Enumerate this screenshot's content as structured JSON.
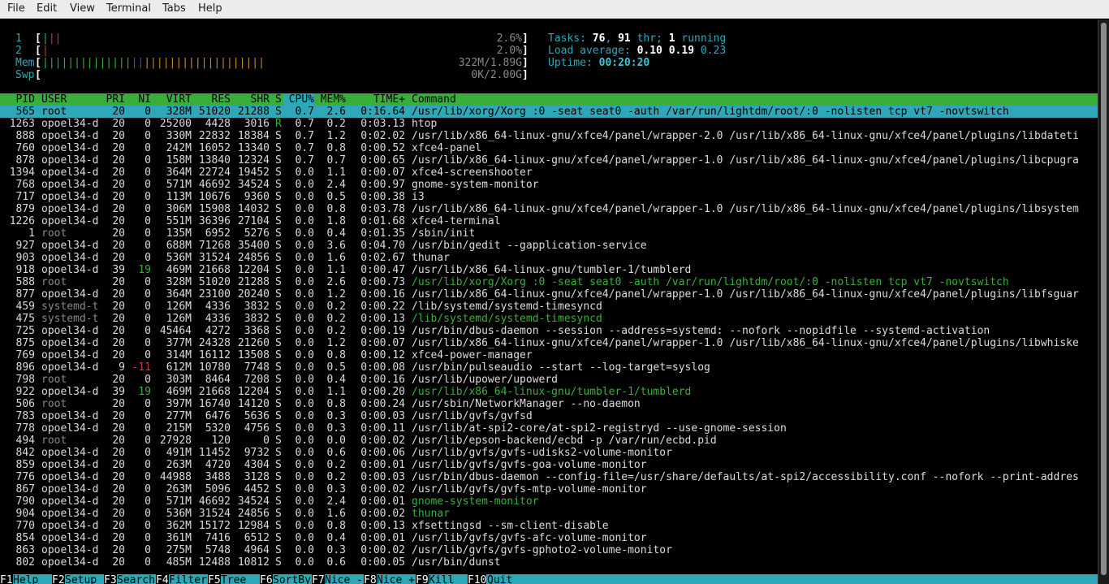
{
  "menubar": {
    "items": [
      "File",
      "Edit",
      "View",
      "Terminal",
      "Tabs",
      "Help"
    ]
  },
  "meters": {
    "cpu1": {
      "label": "1",
      "value": "2.6%"
    },
    "cpu2": {
      "label": "2",
      "value": "2.0%"
    },
    "mem": {
      "label": "Mem",
      "value": "322M/1.89G"
    },
    "swp": {
      "label": "Swp",
      "value": "0K/2.00G"
    }
  },
  "summary": {
    "tasks_label": "Tasks: ",
    "tasks": "76",
    "sep1": ", ",
    "threads": "91",
    "thr_label": " thr; ",
    "running": "1",
    "running_label": " running",
    "load_label": "Load average: ",
    "load1": "0.10",
    "load5": "0.19",
    "load15": "0.23",
    "uptime_label": "Uptime: ",
    "uptime": "00:20:20"
  },
  "columns": [
    "PID",
    "USER",
    "PRI",
    "NI",
    "VIRT",
    "RES",
    "SHR",
    "S",
    "CPU%",
    "MEM%",
    "TIME+",
    "Command"
  ],
  "colors": {
    "cyan": "#2ea8b8",
    "green": "#3aae3a",
    "header_bg": "#3aae3a",
    "selected_bg": "#2ea8b8"
  },
  "processes": [
    {
      "pid": "565",
      "user": "root",
      "pri": "20",
      "ni": "0",
      "virt": "328M",
      "res": "51020",
      "shr": "21288",
      "s": "S",
      "cpu": "0.7",
      "mem": "2.6",
      "time": "0:16.64",
      "cmd": "/usr/lib/xorg/Xorg :0 -seat seat0 -auth /var/run/lightdm/root/:0 -nolisten tcp vt7 -novtswitch",
      "sel": true
    },
    {
      "pid": "1263",
      "user": "opoel34-d",
      "pri": "20",
      "ni": "0",
      "virt": "25200",
      "res": "4428",
      "shr": "3016",
      "s": "R",
      "cpu": "0.7",
      "mem": "0.2",
      "time": "0:03.13",
      "cmd": "htop"
    },
    {
      "pid": "888",
      "user": "opoel34-d",
      "pri": "20",
      "ni": "0",
      "virt": "330M",
      "res": "22832",
      "shr": "18384",
      "s": "S",
      "cpu": "0.7",
      "mem": "1.2",
      "time": "0:02.02",
      "cmd": "/usr/lib/x86_64-linux-gnu/xfce4/panel/wrapper-2.0 /usr/lib/x86_64-linux-gnu/xfce4/panel/plugins/libdateti"
    },
    {
      "pid": "760",
      "user": "opoel34-d",
      "pri": "20",
      "ni": "0",
      "virt": "242M",
      "res": "16052",
      "shr": "13340",
      "s": "S",
      "cpu": "0.7",
      "mem": "0.8",
      "time": "0:00.52",
      "cmd": "xfce4-panel"
    },
    {
      "pid": "878",
      "user": "opoel34-d",
      "pri": "20",
      "ni": "0",
      "virt": "158M",
      "res": "13840",
      "shr": "12324",
      "s": "S",
      "cpu": "0.7",
      "mem": "0.7",
      "time": "0:00.65",
      "cmd": "/usr/lib/x86_64-linux-gnu/xfce4/panel/wrapper-1.0 /usr/lib/x86_64-linux-gnu/xfce4/panel/plugins/libcpugra"
    },
    {
      "pid": "1394",
      "user": "opoel34-d",
      "pri": "20",
      "ni": "0",
      "virt": "364M",
      "res": "22724",
      "shr": "19452",
      "s": "S",
      "cpu": "0.0",
      "mem": "1.1",
      "time": "0:00.07",
      "cmd": "xfce4-screenshooter"
    },
    {
      "pid": "768",
      "user": "opoel34-d",
      "pri": "20",
      "ni": "0",
      "virt": "571M",
      "res": "46692",
      "shr": "34524",
      "s": "S",
      "cpu": "0.0",
      "mem": "2.4",
      "time": "0:00.97",
      "cmd": "gnome-system-monitor"
    },
    {
      "pid": "717",
      "user": "opoel34-d",
      "pri": "20",
      "ni": "0",
      "virt": "113M",
      "res": "10676",
      "shr": "9360",
      "s": "S",
      "cpu": "0.0",
      "mem": "0.5",
      "time": "0:00.38",
      "cmd": "i3"
    },
    {
      "pid": "879",
      "user": "opoel34-d",
      "pri": "20",
      "ni": "0",
      "virt": "306M",
      "res": "15908",
      "shr": "14032",
      "s": "S",
      "cpu": "0.0",
      "mem": "0.8",
      "time": "0:03.78",
      "cmd": "/usr/lib/x86_64-linux-gnu/xfce4/panel/wrapper-1.0 /usr/lib/x86_64-linux-gnu/xfce4/panel/plugins/libsystem"
    },
    {
      "pid": "1226",
      "user": "opoel34-d",
      "pri": "20",
      "ni": "0",
      "virt": "551M",
      "res": "36396",
      "shr": "27104",
      "s": "S",
      "cpu": "0.0",
      "mem": "1.8",
      "time": "0:01.68",
      "cmd": "xfce4-terminal"
    },
    {
      "pid": "1",
      "user": "root",
      "pri": "20",
      "ni": "0",
      "virt": "135M",
      "res": "6952",
      "shr": "5276",
      "s": "S",
      "cpu": "0.0",
      "mem": "0.4",
      "time": "0:01.35",
      "cmd": "/sbin/init"
    },
    {
      "pid": "927",
      "user": "opoel34-d",
      "pri": "20",
      "ni": "0",
      "virt": "688M",
      "res": "71268",
      "shr": "35400",
      "s": "S",
      "cpu": "0.0",
      "mem": "3.6",
      "time": "0:04.70",
      "cmd": "/usr/bin/gedit --gapplication-service"
    },
    {
      "pid": "903",
      "user": "opoel34-d",
      "pri": "20",
      "ni": "0",
      "virt": "536M",
      "res": "31524",
      "shr": "24856",
      "s": "S",
      "cpu": "0.0",
      "mem": "1.6",
      "time": "0:02.67",
      "cmd": "thunar"
    },
    {
      "pid": "918",
      "user": "opoel34-d",
      "pri": "39",
      "ni": "19",
      "virt": "469M",
      "res": "21668",
      "shr": "12204",
      "s": "S",
      "cpu": "0.0",
      "mem": "1.1",
      "time": "0:00.47",
      "cmd": "/usr/lib/x86_64-linux-gnu/tumbler-1/tumblerd"
    },
    {
      "pid": "588",
      "user": "root",
      "pri": "20",
      "ni": "0",
      "virt": "328M",
      "res": "51020",
      "shr": "21288",
      "s": "S",
      "cpu": "0.0",
      "mem": "2.6",
      "time": "0:00.73",
      "cmd": "/usr/lib/xorg/Xorg :0 -seat seat0 -auth /var/run/lightdm/root/:0 -nolisten tcp vt7 -novtswitch",
      "thread": true
    },
    {
      "pid": "877",
      "user": "opoel34-d",
      "pri": "20",
      "ni": "0",
      "virt": "364M",
      "res": "23100",
      "shr": "20240",
      "s": "S",
      "cpu": "0.0",
      "mem": "1.2",
      "time": "0:00.16",
      "cmd": "/usr/lib/x86_64-linux-gnu/xfce4/panel/wrapper-1.0 /usr/lib/x86_64-linux-gnu/xfce4/panel/plugins/libfsguar"
    },
    {
      "pid": "459",
      "user": "systemd-t",
      "pri": "20",
      "ni": "0",
      "virt": "126M",
      "res": "4336",
      "shr": "3832",
      "s": "S",
      "cpu": "0.0",
      "mem": "0.2",
      "time": "0:00.22",
      "cmd": "/lib/systemd/systemd-timesyncd"
    },
    {
      "pid": "475",
      "user": "systemd-t",
      "pri": "20",
      "ni": "0",
      "virt": "126M",
      "res": "4336",
      "shr": "3832",
      "s": "S",
      "cpu": "0.0",
      "mem": "0.2",
      "time": "0:00.13",
      "cmd": "/lib/systemd/systemd-timesyncd",
      "thread": true
    },
    {
      "pid": "725",
      "user": "opoel34-d",
      "pri": "20",
      "ni": "0",
      "virt": "45464",
      "res": "4272",
      "shr": "3368",
      "s": "S",
      "cpu": "0.0",
      "mem": "0.2",
      "time": "0:00.19",
      "cmd": "/usr/bin/dbus-daemon --session --address=systemd: --nofork --nopidfile --systemd-activation"
    },
    {
      "pid": "875",
      "user": "opoel34-d",
      "pri": "20",
      "ni": "0",
      "virt": "377M",
      "res": "24328",
      "shr": "21260",
      "s": "S",
      "cpu": "0.0",
      "mem": "1.2",
      "time": "0:00.07",
      "cmd": "/usr/lib/x86_64-linux-gnu/xfce4/panel/wrapper-1.0 /usr/lib/x86_64-linux-gnu/xfce4/panel/plugins/libwhiske"
    },
    {
      "pid": "769",
      "user": "opoel34-d",
      "pri": "20",
      "ni": "0",
      "virt": "314M",
      "res": "16112",
      "shr": "13508",
      "s": "S",
      "cpu": "0.0",
      "mem": "0.8",
      "time": "0:00.12",
      "cmd": "xfce4-power-manager"
    },
    {
      "pid": "896",
      "user": "opoel34-d",
      "pri": "9",
      "ni": "-11",
      "virt": "612M",
      "res": "10780",
      "shr": "7748",
      "s": "S",
      "cpu": "0.0",
      "mem": "0.5",
      "time": "0:00.08",
      "cmd": "/usr/bin/pulseaudio --start --log-target=syslog"
    },
    {
      "pid": "798",
      "user": "root",
      "pri": "20",
      "ni": "0",
      "virt": "303M",
      "res": "8464",
      "shr": "7208",
      "s": "S",
      "cpu": "0.0",
      "mem": "0.4",
      "time": "0:00.16",
      "cmd": "/usr/lib/upower/upowerd"
    },
    {
      "pid": "922",
      "user": "opoel34-d",
      "pri": "39",
      "ni": "19",
      "virt": "469M",
      "res": "21668",
      "shr": "12204",
      "s": "S",
      "cpu": "0.0",
      "mem": "1.1",
      "time": "0:00.20",
      "cmd": "/usr/lib/x86_64-linux-gnu/tumbler-1/tumblerd",
      "thread": true
    },
    {
      "pid": "506",
      "user": "root",
      "pri": "20",
      "ni": "0",
      "virt": "397M",
      "res": "16740",
      "shr": "14120",
      "s": "S",
      "cpu": "0.0",
      "mem": "0.8",
      "time": "0:00.24",
      "cmd": "/usr/sbin/NetworkManager --no-daemon"
    },
    {
      "pid": "783",
      "user": "opoel34-d",
      "pri": "20",
      "ni": "0",
      "virt": "277M",
      "res": "6476",
      "shr": "5636",
      "s": "S",
      "cpu": "0.0",
      "mem": "0.3",
      "time": "0:00.03",
      "cmd": "/usr/lib/gvfs/gvfsd"
    },
    {
      "pid": "778",
      "user": "opoel34-d",
      "pri": "20",
      "ni": "0",
      "virt": "215M",
      "res": "5320",
      "shr": "4756",
      "s": "S",
      "cpu": "0.0",
      "mem": "0.3",
      "time": "0:00.11",
      "cmd": "/usr/lib/at-spi2-core/at-spi2-registryd --use-gnome-session"
    },
    {
      "pid": "494",
      "user": "root",
      "pri": "20",
      "ni": "0",
      "virt": "27928",
      "res": "120",
      "shr": "0",
      "s": "S",
      "cpu": "0.0",
      "mem": "0.0",
      "time": "0:00.02",
      "cmd": "/usr/lib/epson-backend/ecbd -p /var/run/ecbd.pid"
    },
    {
      "pid": "842",
      "user": "opoel34-d",
      "pri": "20",
      "ni": "0",
      "virt": "491M",
      "res": "11452",
      "shr": "9732",
      "s": "S",
      "cpu": "0.0",
      "mem": "0.6",
      "time": "0:00.06",
      "cmd": "/usr/lib/gvfs/gvfs-udisks2-volume-monitor"
    },
    {
      "pid": "859",
      "user": "opoel34-d",
      "pri": "20",
      "ni": "0",
      "virt": "263M",
      "res": "4720",
      "shr": "4304",
      "s": "S",
      "cpu": "0.0",
      "mem": "0.2",
      "time": "0:00.01",
      "cmd": "/usr/lib/gvfs/gvfs-goa-volume-monitor"
    },
    {
      "pid": "776",
      "user": "opoel34-d",
      "pri": "20",
      "ni": "0",
      "virt": "44988",
      "res": "3488",
      "shr": "3128",
      "s": "S",
      "cpu": "0.0",
      "mem": "0.2",
      "time": "0:00.03",
      "cmd": "/usr/bin/dbus-daemon --config-file=/usr/share/defaults/at-spi2/accessibility.conf --nofork --print-addres"
    },
    {
      "pid": "867",
      "user": "opoel34-d",
      "pri": "20",
      "ni": "0",
      "virt": "263M",
      "res": "5096",
      "shr": "4452",
      "s": "S",
      "cpu": "0.0",
      "mem": "0.3",
      "time": "0:00.02",
      "cmd": "/usr/lib/gvfs/gvfs-mtp-volume-monitor"
    },
    {
      "pid": "790",
      "user": "opoel34-d",
      "pri": "20",
      "ni": "0",
      "virt": "571M",
      "res": "46692",
      "shr": "34524",
      "s": "S",
      "cpu": "0.0",
      "mem": "2.4",
      "time": "0:00.01",
      "cmd": "gnome-system-monitor",
      "thread": true
    },
    {
      "pid": "904",
      "user": "opoel34-d",
      "pri": "20",
      "ni": "0",
      "virt": "536M",
      "res": "31524",
      "shr": "24856",
      "s": "S",
      "cpu": "0.0",
      "mem": "1.6",
      "time": "0:00.02",
      "cmd": "thunar",
      "thread": true
    },
    {
      "pid": "770",
      "user": "opoel34-d",
      "pri": "20",
      "ni": "0",
      "virt": "362M",
      "res": "15172",
      "shr": "12984",
      "s": "S",
      "cpu": "0.0",
      "mem": "0.8",
      "time": "0:00.13",
      "cmd": "xfsettingsd --sm-client-disable"
    },
    {
      "pid": "854",
      "user": "opoel34-d",
      "pri": "20",
      "ni": "0",
      "virt": "361M",
      "res": "7416",
      "shr": "6512",
      "s": "S",
      "cpu": "0.0",
      "mem": "0.4",
      "time": "0:00.01",
      "cmd": "/usr/lib/gvfs/gvfs-afc-volume-monitor"
    },
    {
      "pid": "863",
      "user": "opoel34-d",
      "pri": "20",
      "ni": "0",
      "virt": "275M",
      "res": "5748",
      "shr": "4964",
      "s": "S",
      "cpu": "0.0",
      "mem": "0.3",
      "time": "0:00.02",
      "cmd": "/usr/lib/gvfs/gvfs-gphoto2-volume-monitor"
    },
    {
      "pid": "802",
      "user": "opoel34-d",
      "pri": "20",
      "ni": "0",
      "virt": "485M",
      "res": "12488",
      "shr": "10812",
      "s": "S",
      "cpu": "0.0",
      "mem": "0.6",
      "time": "0:00.05",
      "cmd": "/usr/bin/dunst"
    }
  ],
  "footer": [
    {
      "key": "F1",
      "label": "Help  "
    },
    {
      "key": "F2",
      "label": "Setup "
    },
    {
      "key": "F3",
      "label": "Search"
    },
    {
      "key": "F4",
      "label": "Filter"
    },
    {
      "key": "F5",
      "label": "Tree  "
    },
    {
      "key": "F6",
      "label": "SortBy"
    },
    {
      "key": "F7",
      "label": "Nice -"
    },
    {
      "key": "F8",
      "label": "Nice +"
    },
    {
      "key": "F9",
      "label": "Kill  "
    },
    {
      "key": "F10",
      "label": "Quit"
    }
  ]
}
